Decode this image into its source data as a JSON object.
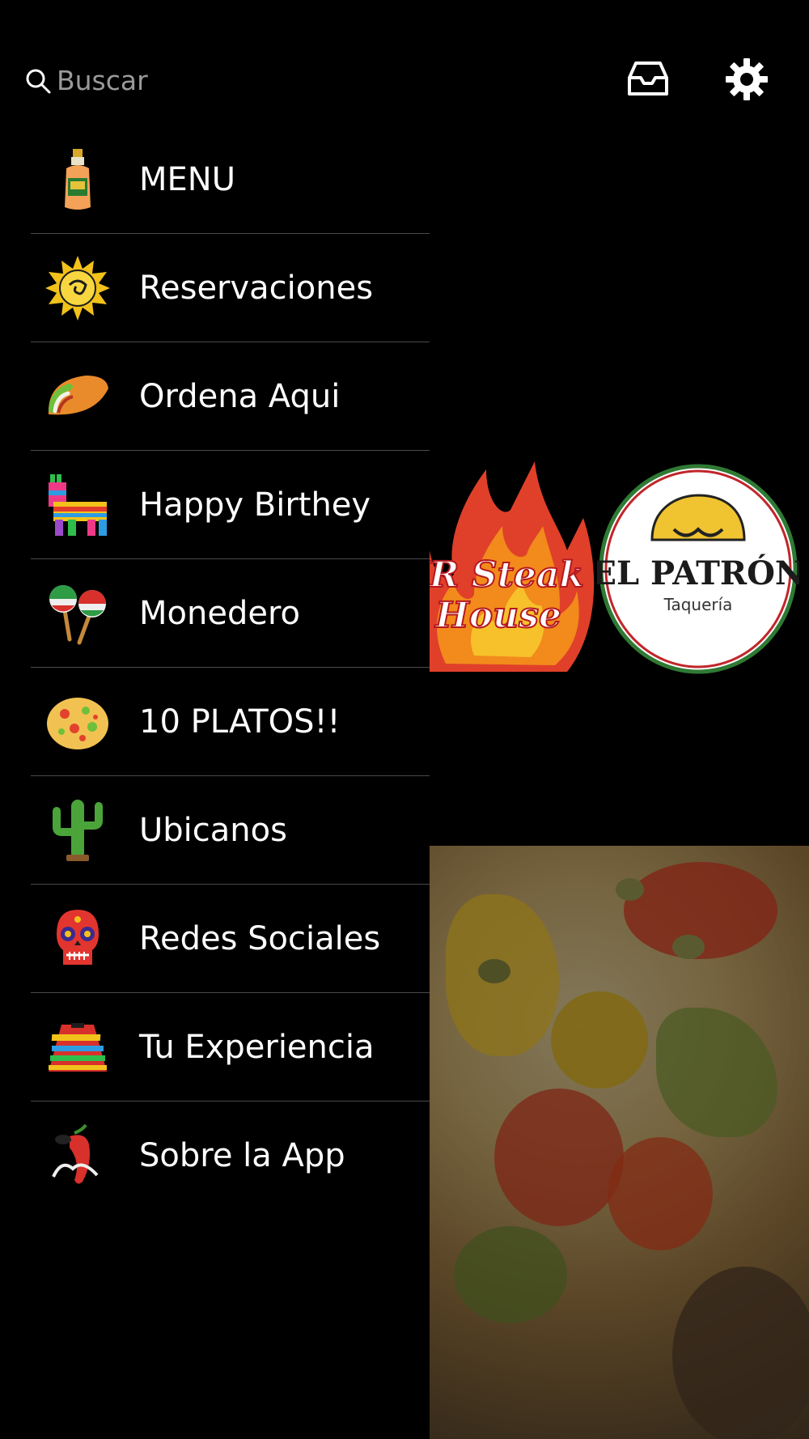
{
  "search": {
    "placeholder": "Buscar",
    "icon": "search-icon"
  },
  "header_icons": [
    {
      "name": "inbox-icon"
    },
    {
      "name": "settings-icon"
    }
  ],
  "menu": [
    {
      "label": "MENU",
      "icon": "tequila-bottle-icon"
    },
    {
      "label": "Reservaciones",
      "icon": "sun-icon"
    },
    {
      "label": "Ordena Aqui",
      "icon": "taco-icon"
    },
    {
      "label": "Happy Birthey",
      "icon": "pinata-icon"
    },
    {
      "label": "Monedero",
      "icon": "maracas-icon"
    },
    {
      "label": "10 PLATOS!!",
      "icon": "nachos-plate-icon"
    },
    {
      "label": "Ubicanos",
      "icon": "cactus-icon"
    },
    {
      "label": "Redes Sociales",
      "icon": "sugar-skull-icon"
    },
    {
      "label": "Tu Experiencia",
      "icon": "poncho-icon"
    },
    {
      "label": "Sobre la App",
      "icon": "chili-pepper-icon"
    }
  ],
  "background": {
    "logos": [
      {
        "name": "JR Steak House",
        "line1": "JR Steak",
        "line2": "House"
      },
      {
        "name": "EL PATRÓN",
        "title": "EL PATRÓN",
        "subtitle": "Taquería"
      }
    ]
  }
}
